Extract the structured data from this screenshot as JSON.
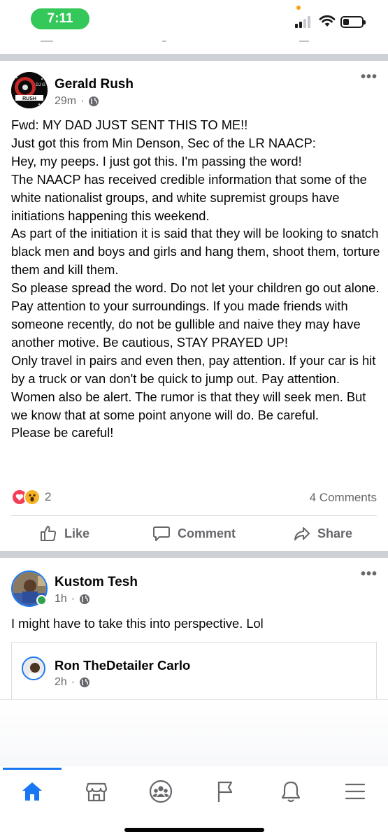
{
  "status_bar": {
    "time": "7:11"
  },
  "posts": [
    {
      "author": "Gerald Rush",
      "time": "29m",
      "text_lines": [
        "Fwd: MY DAD JUST SENT THIS TO ME!!",
        "Just got this from Min Denson,  Sec of the  LR NAACP:",
        "Hey, my peeps. I just got this. I'm passing the word!",
        "The NAACP has received credible information that some of the white nationalist groups, and white supremist groups have initiations happening this weekend.",
        "As part of the initiation it is said that they will be looking to snatch black men and boys and girls and hang them, shoot them, torture them and kill them.",
        "So please spread the word. Do not let your children go out alone. Pay attention to your surroundings. If you made friends with someone recently, do not be gullible and naive they may have another motive. Be cautious, STAY PRAYED UP!",
        "Only travel in pairs and even then, pay attention. If your car is hit by a truck or van don't be quick to jump out. Pay attention. Women also be alert. The rumor is that they will seek men. But we know that at some point anyone will do. Be careful.",
        "Please be careful!"
      ],
      "reaction_count": "2",
      "comments": "4 Comments",
      "actions": {
        "like": "Like",
        "comment": "Comment",
        "share": "Share"
      }
    },
    {
      "author": "Kustom Tesh",
      "time": "1h",
      "text": "I might have to take this into perspective.  Lol",
      "shared": {
        "author": "Ron TheDetailer Carlo",
        "time": "2h"
      }
    }
  ],
  "avatar_lettering": "DJ G RUSH",
  "colors": {
    "accent": "#1877f2",
    "secondary_text": "#65676b",
    "divider": "#cdd0d4",
    "time_pill": "#34c759",
    "online": "#31a24c"
  },
  "icons": [
    "globe-icon",
    "more-icon",
    "like-icon",
    "comment-icon",
    "share-icon",
    "home-icon",
    "marketplace-icon",
    "groups-icon",
    "pages-icon",
    "notifications-icon",
    "menu-icon"
  ]
}
